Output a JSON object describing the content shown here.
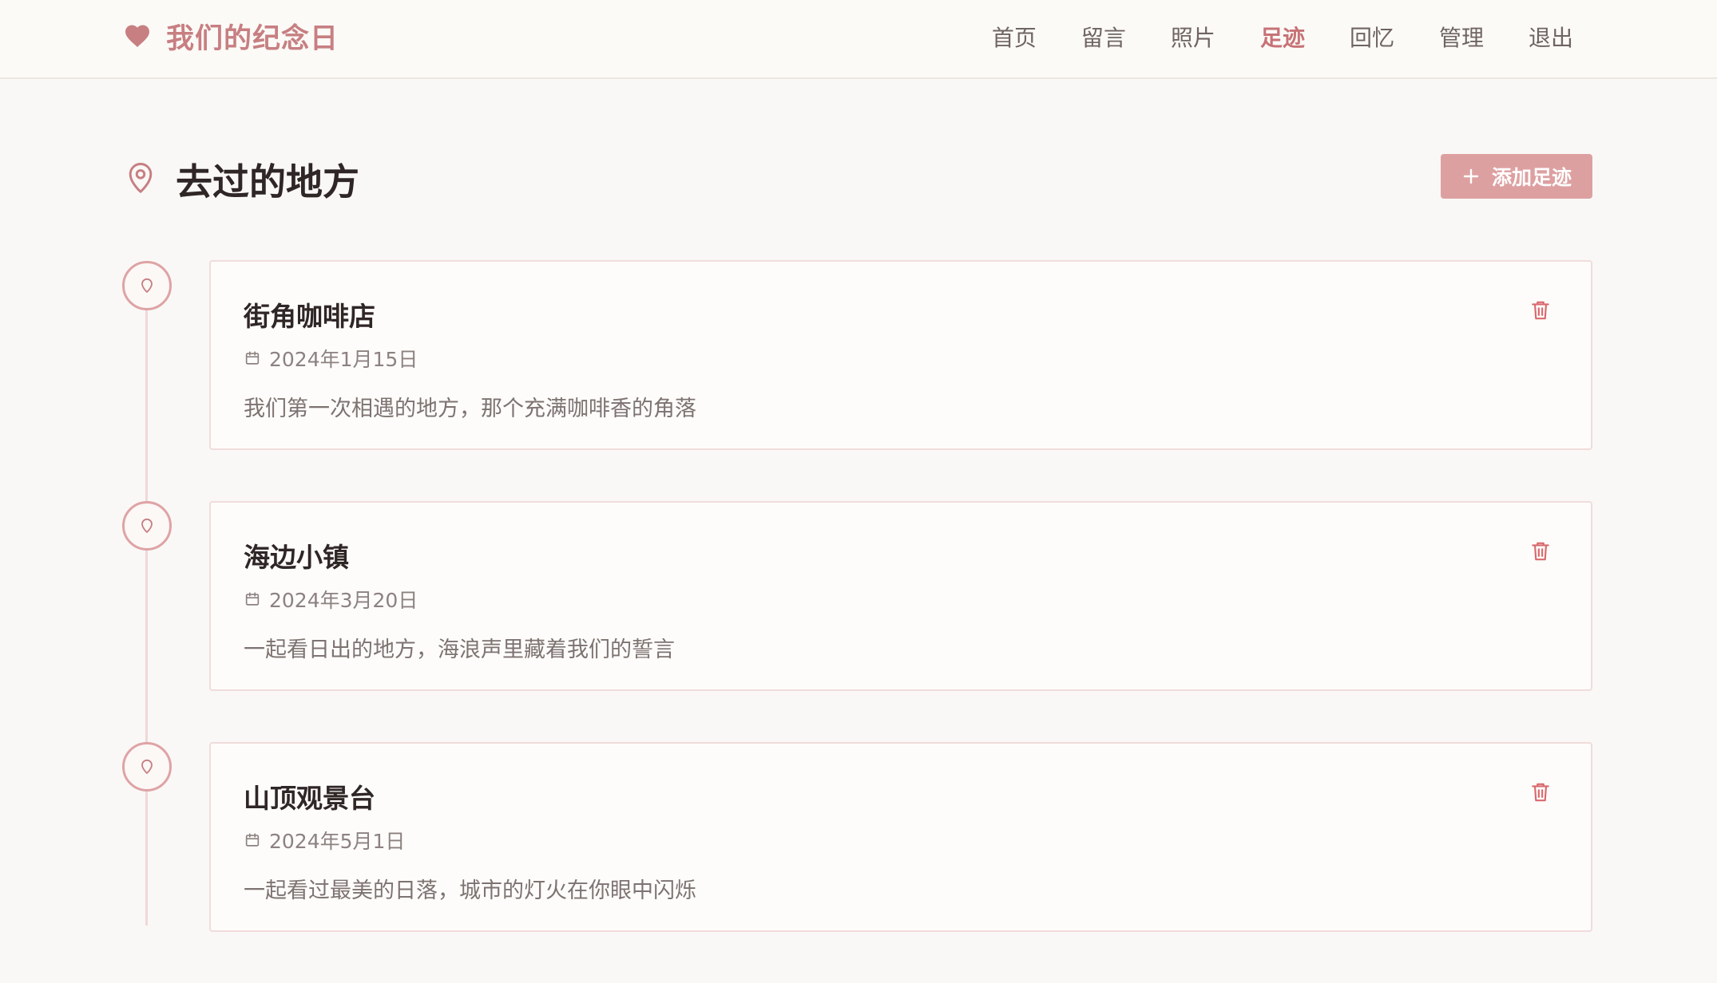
{
  "brand": {
    "title": "我们的纪念日",
    "icon": "heart-icon",
    "color": "#c77f82"
  },
  "nav": {
    "items": [
      "首页",
      "留言",
      "照片",
      "足迹",
      "回忆",
      "管理",
      "退出"
    ],
    "active": "足迹",
    "active_color": "#c77276"
  },
  "page": {
    "title": "去过的地方",
    "title_icon": "map-pin-icon",
    "add_label": "添加足迹",
    "add_icon": "plus-icon",
    "accent": "#dda0a1"
  },
  "places": [
    {
      "name": "街角咖啡店",
      "date": "2024年1月15日",
      "description": "我们第一次相遇的地方，那个充满咖啡香的角落"
    },
    {
      "name": "海边小镇",
      "date": "2024年3月20日",
      "description": "一起看日出的地方，海浪声里藏着我们的誓言"
    },
    {
      "name": "山顶观景台",
      "date": "2024年5月1日",
      "description": "一起看过最美的日落，城市的灯火在你眼中闪烁"
    }
  ],
  "icons": {
    "date": "calendar-icon",
    "delete": "trash-icon",
    "marker": "location-pin-icon"
  },
  "colors": {
    "delete": "#d9696d",
    "marker_border": "#dfa3a5"
  }
}
